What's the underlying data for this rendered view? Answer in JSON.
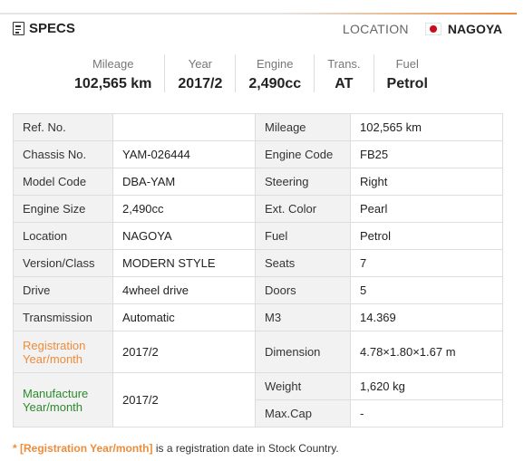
{
  "header": {
    "title": "SPECS",
    "location_label": "LOCATION",
    "location_value": "NAGOYA"
  },
  "summary": [
    {
      "label": "Mileage",
      "value": "102,565 km"
    },
    {
      "label": "Year",
      "value": "2017/2"
    },
    {
      "label": "Engine",
      "value": "2,490cc"
    },
    {
      "label": "Trans.",
      "value": "AT"
    },
    {
      "label": "Fuel",
      "value": "Petrol"
    }
  ],
  "table": {
    "rows": [
      {
        "l1": "Ref. No.",
        "v1": "",
        "l2": "Mileage",
        "v2": "102,565 km"
      },
      {
        "l1": "Chassis No.",
        "v1": "YAM-026444",
        "l2": "Engine Code",
        "v2": "FB25"
      },
      {
        "l1": "Model Code",
        "v1": "DBA-YAM",
        "l2": "Steering",
        "v2": "Right"
      },
      {
        "l1": "Engine Size",
        "v1": "2,490cc",
        "l2": "Ext. Color",
        "v2": "Pearl"
      },
      {
        "l1": "Location",
        "v1": "NAGOYA",
        "l2": "Fuel",
        "v2": "Petrol"
      },
      {
        "l1": "Version/Class",
        "v1": "MODERN STYLE",
        "l2": "Seats",
        "v2": "7"
      },
      {
        "l1": "Drive",
        "v1": "4wheel drive",
        "l2": "Doors",
        "v2": "5"
      },
      {
        "l1": "Transmission",
        "v1": "Automatic",
        "l2": "M3",
        "v2": "14.369"
      },
      {
        "l1": "Registration Year/month",
        "v1": "2017/2",
        "l2": "Dimension",
        "v2": "4.78×1.80×1.67 m"
      },
      {
        "l1": "Manufacture Year/month",
        "v1": "2017/2",
        "l2": "Weight",
        "v2": "1,620 kg"
      },
      {
        "l2": "Max.Cap",
        "v2": "-"
      }
    ]
  },
  "footnote": {
    "asterisk": "* ",
    "highlight": "[Registration Year/month]",
    "text": " is a registration date in Stock Country."
  },
  "colors": {
    "accent": "#ee8c3a",
    "manufacture_label": "#2c8a2c",
    "japan_flag_red": "#cc0a1e"
  },
  "icons": [
    "document-icon",
    "japan-flag-icon"
  ]
}
